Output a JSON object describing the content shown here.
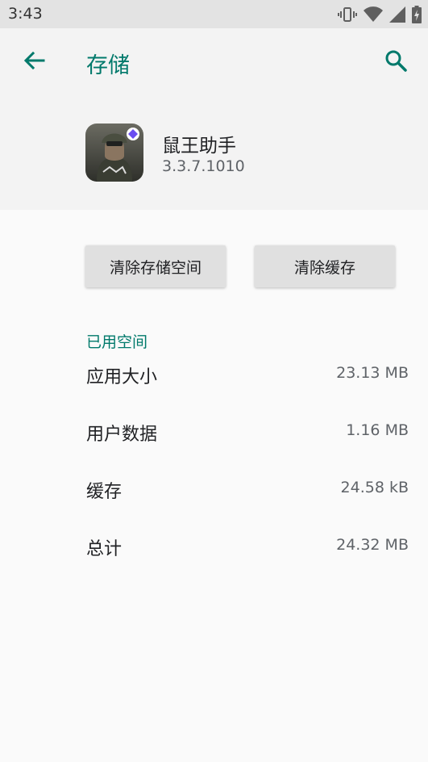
{
  "status_bar": {
    "time": "3:43",
    "icons": [
      "vibrate-icon",
      "wifi-icon",
      "signal-icon",
      "battery-charging-icon"
    ]
  },
  "app_bar": {
    "title": "存储",
    "back_icon": "arrow-back-icon",
    "search_icon": "search-icon"
  },
  "app_info": {
    "name": "鼠王助手",
    "version": "3.3.7.1010"
  },
  "actions": {
    "clear_storage": "清除存储空间",
    "clear_cache": "清除缓存"
  },
  "storage": {
    "section_title": "已用空间",
    "rows": [
      {
        "label": "应用大小",
        "value": "23.13 MB"
      },
      {
        "label": "用户数据",
        "value": "1.16 MB"
      },
      {
        "label": "缓存",
        "value": "24.58 kB"
      },
      {
        "label": "总计",
        "value": "24.32 MB"
      }
    ]
  },
  "colors": {
    "accent": "#00796b",
    "status_bar_bg": "#e3e3e3",
    "header_bg": "#f3f3f3",
    "page_bg": "#fafafa",
    "button_bg": "#e0e0e0"
  }
}
